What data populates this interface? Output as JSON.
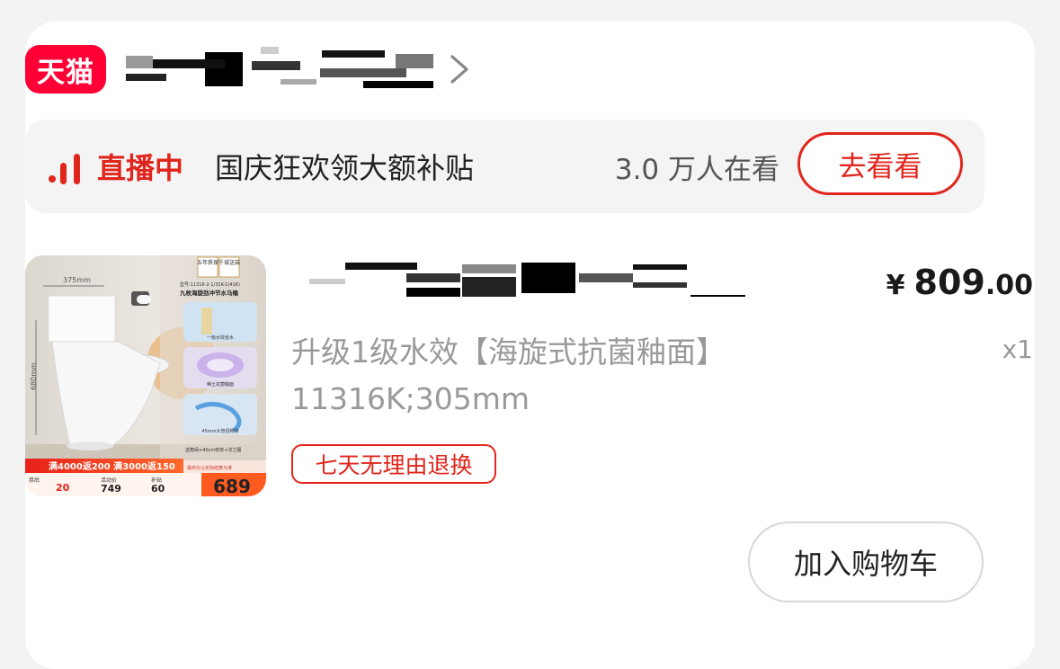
{
  "shop": {
    "badge": "天猫"
  },
  "live": {
    "status_label": "直播中",
    "title": "国庆狂欢领大额补贴",
    "viewers": "3.0 万人在看",
    "watch_button": "去看看"
  },
  "product": {
    "price_currency": "¥",
    "price_int": "809",
    "price_dec": ".00",
    "sku": "升级1级水效【海旋式抗菌釉面】11316K;305mm",
    "quantity": "x1",
    "return_policy": "七天无理由退换",
    "image": {
      "dim_width": "375mm",
      "dim_height": "680mm",
      "dim_depth": "670mm",
      "tag_warranty": "五年质保",
      "tag_shipping": "千城送装",
      "model_line": "型号:11316-2-1/31K-1(41K)",
      "headline": "九枚海旋劲冲节水马桶",
      "feature_1": "一级水效省水",
      "feature_2": "稀土抗菌釉面",
      "feature_3": "45mm大管径畅排",
      "gift_line": "送角阀+40cm软管+法兰圈",
      "promo_banner": "满4000返200 满3000返150",
      "promo_note": "最终价以实际结算为准",
      "p1_label": "券后",
      "p1_value": "20",
      "p2_label": "活动价",
      "p2_value": "749",
      "p3_label": "补贴",
      "p3_value": "60",
      "final_price": "689"
    }
  },
  "actions": {
    "add_to_cart": "加入购物车"
  },
  "colors": {
    "tmall_red": "#ff0036",
    "accent_red": "#e0261c"
  }
}
